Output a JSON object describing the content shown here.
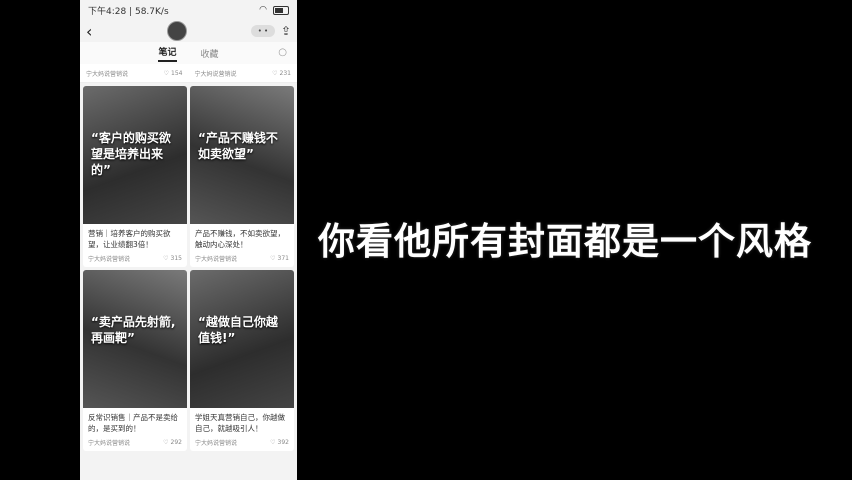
{
  "status": {
    "time": "下午4:28",
    "speed": "58.7K/s"
  },
  "tabs": [
    {
      "label": "笔记"
    },
    {
      "label": "收藏"
    }
  ],
  "top_row": [
    {
      "author": "宁大妈说营销说",
      "likes": "154"
    },
    {
      "author": "宁大妈说营销说",
      "likes": "231"
    }
  ],
  "cards": [
    {
      "cover_title": "“客户的购买欲望是培养出来的”",
      "desc": "营销｜培养客户的购买欲望，让业绩翻3倍！",
      "author": "宁大妈说营销说",
      "likes": "315"
    },
    {
      "cover_title": "“产品不赚钱不如卖欲望”",
      "desc": "产品不赚钱，不如卖欲望，触动内心深处！",
      "author": "宁大妈说营销说",
      "likes": "371"
    },
    {
      "cover_title": "“卖产品先射箭,再画靶”",
      "desc": "反常识销售｜产品不是卖给的，是买到的！",
      "author": "宁大妈说营销说",
      "likes": "292"
    },
    {
      "cover_title": "“越做自己你越值钱!”",
      "desc": "学姐天真营销自己，你越做自己，就越吸引人！",
      "author": "宁大妈说营销说",
      "likes": "392"
    }
  ],
  "caption": "你看他所有封面都是一个风格"
}
